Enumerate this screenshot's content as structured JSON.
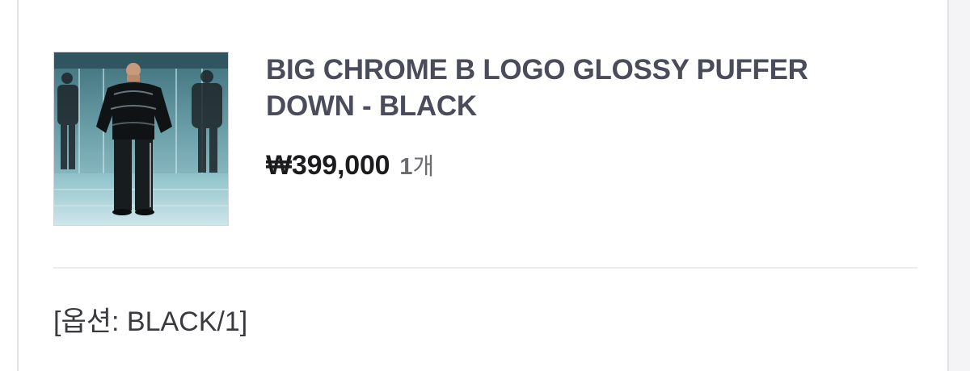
{
  "order_item": {
    "image_alt": "model wearing glossy black puffer down jacket in mirrored room",
    "title": "BIG CHROME B LOGO GLOSSY PUFFER DOWN - BLACK",
    "price": "₩399,000",
    "quantity_number": "1",
    "quantity_unit": "개",
    "option": "[옵션: BLACK/1]"
  },
  "colors": {
    "title": "#4a4c5c",
    "price": "#1c1c1e",
    "muted": "#6b6b70",
    "divider": "#ececee"
  }
}
